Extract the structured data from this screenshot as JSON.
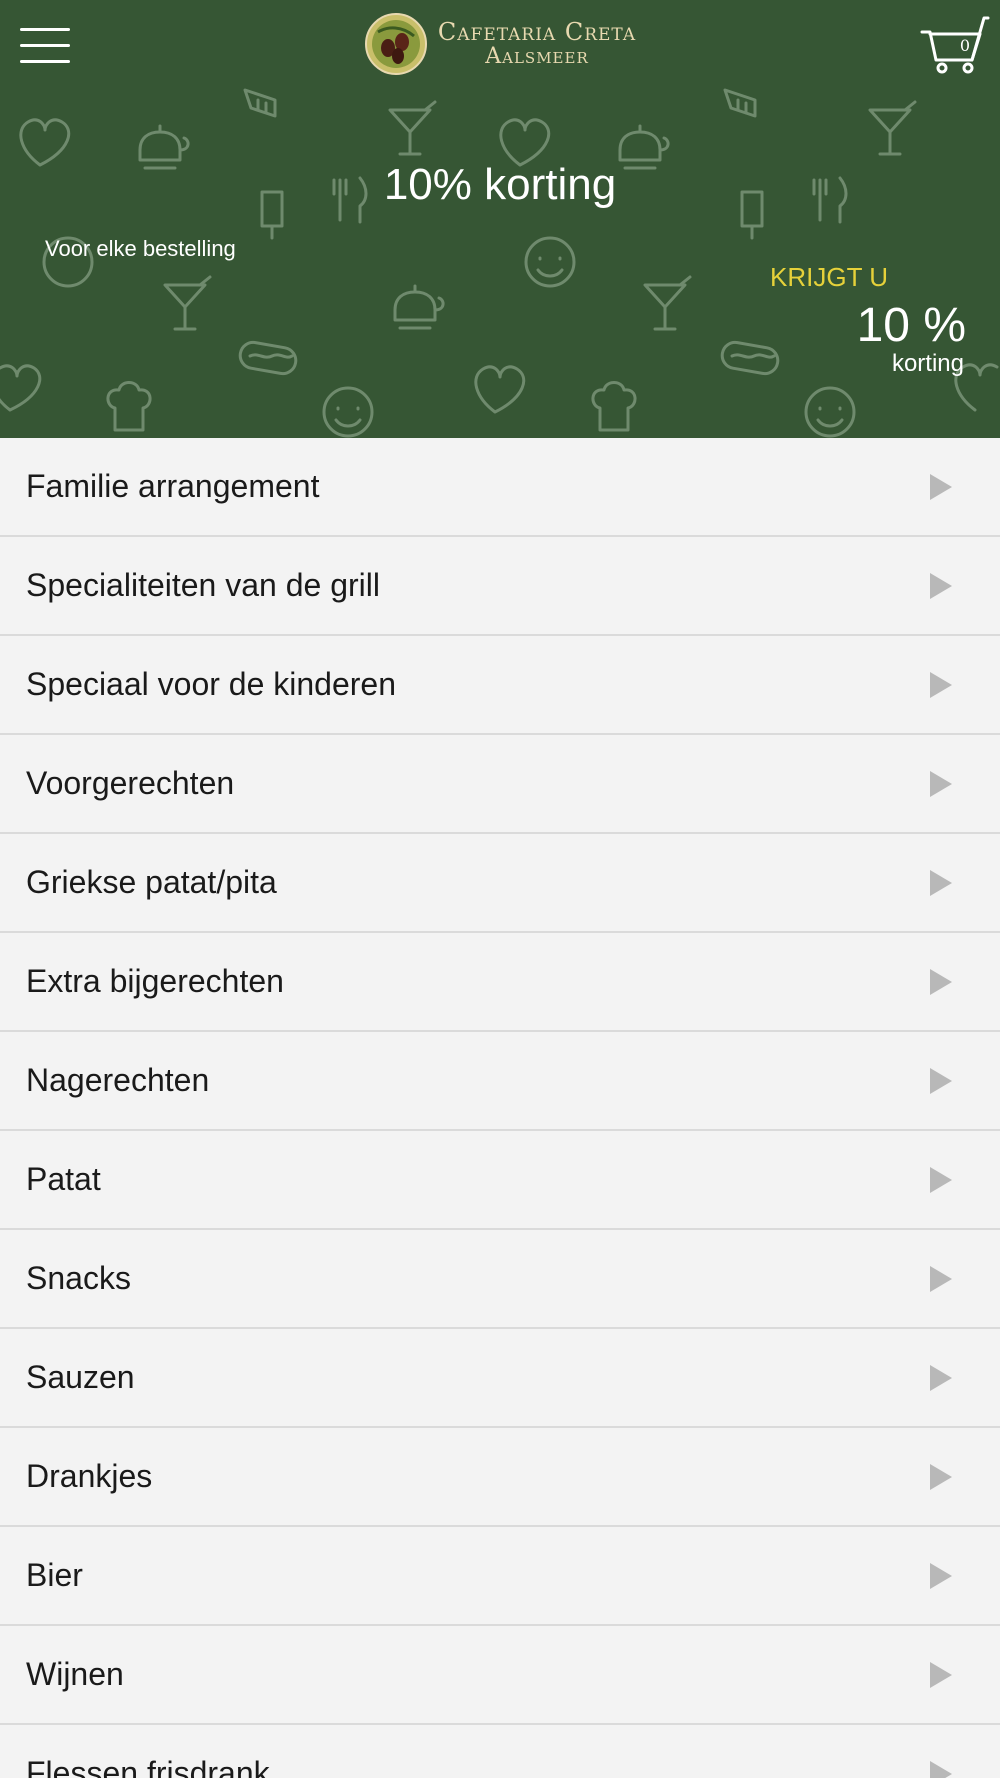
{
  "header": {
    "menu_icon": "hamburger-menu-icon",
    "logo_line1": "Cafetaria Creta",
    "logo_line2": "Aalsmeer",
    "cart_icon": "shopping-cart-icon",
    "cart_count": "0"
  },
  "promo": {
    "title": "10% korting",
    "subtitle": "Voor elke bestelling",
    "krijgt": "KRIJGT U",
    "percent": "10 %",
    "percent_label": "korting"
  },
  "colors": {
    "hero_bg": "#365634",
    "accent_yellow": "#e6d13a",
    "list_bg": "#f3f3f3",
    "divider": "#dadada",
    "arrow": "#b8b8b8"
  },
  "categories": [
    {
      "label": "Familie arrangement"
    },
    {
      "label": "Specialiteiten van de grill"
    },
    {
      "label": "Speciaal voor de kinderen"
    },
    {
      "label": "Voorgerechten"
    },
    {
      "label": "Griekse patat/pita"
    },
    {
      "label": "Extra bijgerechten"
    },
    {
      "label": "Nagerechten"
    },
    {
      "label": "Patat"
    },
    {
      "label": "Snacks"
    },
    {
      "label": "Sauzen"
    },
    {
      "label": "Drankjes"
    },
    {
      "label": "Bier"
    },
    {
      "label": "Wijnen"
    },
    {
      "label": "Flessen frisdrank"
    }
  ]
}
